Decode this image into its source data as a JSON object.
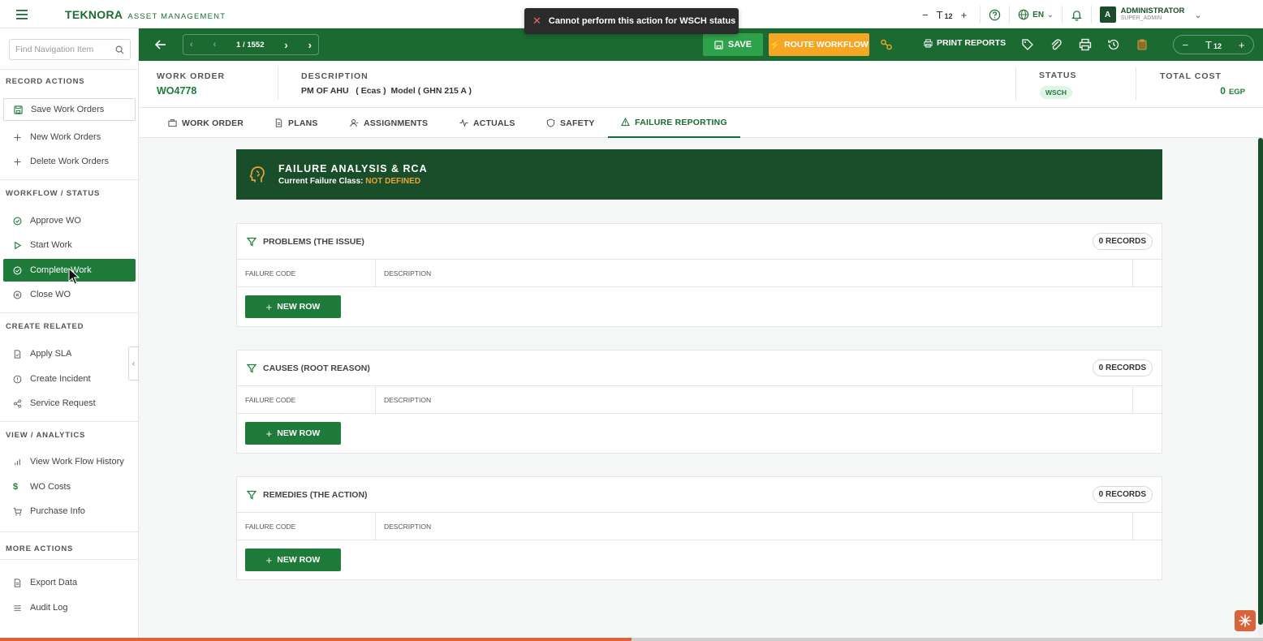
{
  "brand": {
    "name": "TEKNORA",
    "subtitle": "ASSET MANAGEMENT"
  },
  "toast": {
    "message": "Cannot perform this action for WSCH status"
  },
  "topbar": {
    "font_size": "12",
    "language": "EN",
    "user_name": "ADMINISTRATOR",
    "user_role": "SUPER_ADMIN",
    "avatar_letter": "A"
  },
  "sidebar": {
    "search_placeholder": "Find Navigation Item",
    "sections": {
      "record_actions": "RECORD ACTIONS",
      "workflow": "WORKFLOW / STATUS",
      "create_related": "CREATE RELATED",
      "view_analytics": "VIEW / ANALYTICS",
      "more_actions": "MORE ACTIONS"
    },
    "items": {
      "save": "Save Work Orders",
      "new": "New Work Orders",
      "delete": "Delete Work Orders",
      "approve": "Approve WO",
      "start": "Start Work",
      "complete": "Complete Work",
      "close": "Close WO",
      "apply_sla": "Apply SLA",
      "create_incident": "Create Incident",
      "service_request": "Service Request",
      "wf_history": "View Work Flow History",
      "wo_costs": "WO Costs",
      "purchase_info": "Purchase Info",
      "export": "Export Data",
      "audit": "Audit Log"
    }
  },
  "toolbar": {
    "pager_current": "1",
    "pager_total": "1552",
    "save_label": "SAVE",
    "route_label": "ROUTE WORKFLOW",
    "print_label": "PRINT REPORTS",
    "font_size": "12"
  },
  "header": {
    "wo_label": "WORK ORDER",
    "wo_value": "WO4778",
    "desc_label": "DESCRIPTION",
    "desc_value": "PM OF AHU   ( Ecas )  Model ( GHN 215 A )",
    "status_label": "STATUS",
    "status_value": "WSCH",
    "cost_label": "TOTAL COST",
    "cost_value": "0",
    "cost_currency": "EGP"
  },
  "tabs": {
    "work_order": "WORK ORDER",
    "plans": "PLANS",
    "assignments": "ASSIGNMENTS",
    "actuals": "ACTUALS",
    "safety": "SAFETY",
    "failure": "FAILURE REPORTING"
  },
  "rca": {
    "title": "FAILURE ANALYSIS & RCA",
    "subtitle_prefix": "Current Failure Class:",
    "failure_class": "NOT DEFINED"
  },
  "panels": {
    "problems": {
      "title": "PROBLEMS (THE ISSUE)",
      "records": "0 RECORDS"
    },
    "causes": {
      "title": "CAUSES (ROOT REASON)",
      "records": "0 RECORDS"
    },
    "remedies": {
      "title": "REMEDIES (THE ACTION)",
      "records": "0 RECORDS"
    },
    "col_code": "FAILURE CODE",
    "col_desc": "DESCRIPTION",
    "new_row": "NEW ROW"
  },
  "colors": {
    "primary": "#1a6a31",
    "dark": "#1a4d2a",
    "accent": "#f5a623",
    "danger": "#d9633a"
  },
  "progress": {
    "bottom_bar_fraction": 0.5
  }
}
